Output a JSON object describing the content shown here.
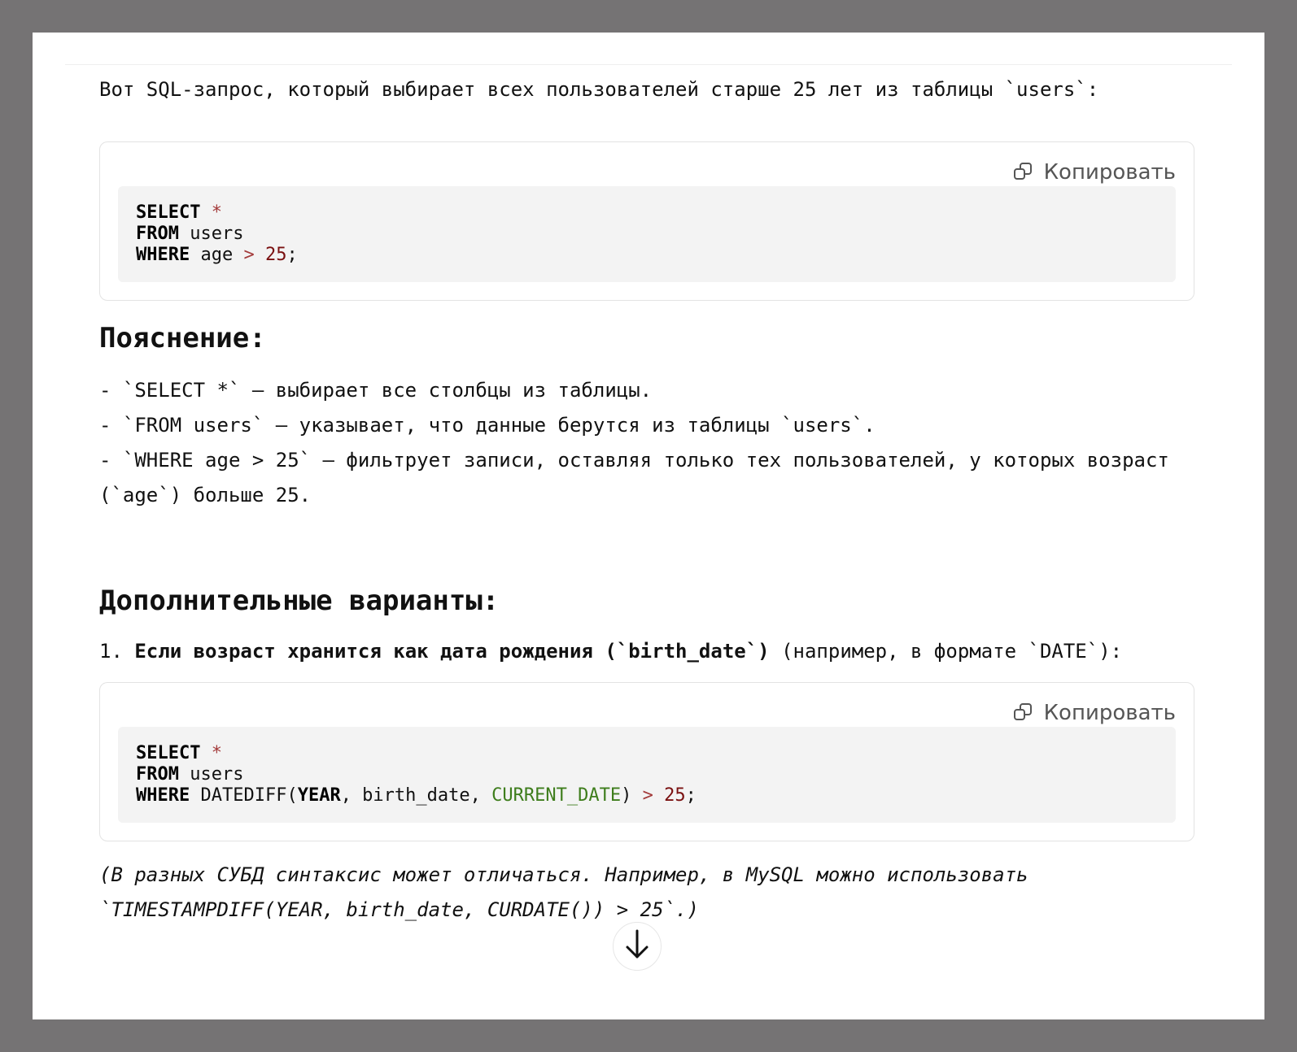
{
  "message": {
    "intro": "Вот SQL-запрос, который выбирает всех пользователей старше 25 лет из таблицы `users`:",
    "code1": {
      "copy_label": "Копировать",
      "line1_kw": "SELECT",
      "line1_op": "*",
      "line2_kw": "FROM",
      "line2_rest": "users",
      "line3_kw": "WHERE",
      "line3_col": "age",
      "line3_op": ">",
      "line3_num": "25",
      "line3_end": ";"
    },
    "explain_heading": "Пояснение:",
    "explain_items": [
      "- `SELECT *` — выбирает все столбцы из таблицы.",
      "- `FROM users` — указывает, что данные берутся из таблицы `users`.",
      "- `WHERE age > 25` — фильтрует записи, оставляя только тех пользователей, у которых возраст (`age`) больше 25."
    ],
    "variants_heading": "Дополнительные варианты:",
    "variant1_number": "1.",
    "variant1_bold": "Если возраст хранится как дата рождения (`birth_date`)",
    "variant1_rest": "(например, в формате `DATE`):",
    "code2": {
      "copy_label": "Копировать",
      "line1_kw": "SELECT",
      "line1_op": "*",
      "line2_kw": "FROM",
      "line2_rest": "users",
      "line3_kw": "WHERE",
      "line3_fn": "DATEDIFF(",
      "line3_year": "YEAR",
      "line3_mid": ", birth_date, ",
      "line3_curdate": "CURRENT_DATE",
      "line3_close": ")",
      "line3_op": ">",
      "line3_num": "25",
      "line3_end": ";"
    },
    "note": "(В разных СУБД синтаксис может отличаться. Например, в MySQL можно использовать `TIMESTAMPDIFF(YEAR, birth_date, CURDATE()) > 25`.)"
  },
  "scroll_button": {
    "icon": "arrow-down-icon"
  }
}
